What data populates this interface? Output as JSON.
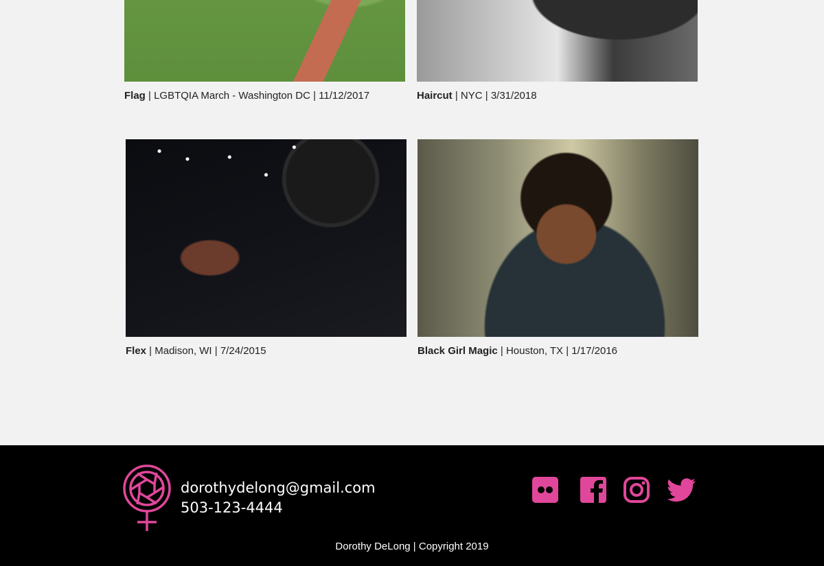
{
  "gallery": {
    "items": [
      {
        "title": "Flag",
        "details": " | LGBTQIA March - Washington DC | 11/12/2017"
      },
      {
        "title": "Haircut",
        "details": " | NYC | 3/31/2018"
      },
      {
        "title": "Flex",
        "details": " | Madison, WI | 7/24/2015"
      },
      {
        "title": "Black Girl Magic",
        "details": " | Houston, TX | 1/17/2016"
      }
    ]
  },
  "footer": {
    "email": "dorothydelong@gmail.com",
    "phone": "503-123-4444",
    "copyright": "Dorothy DeLong | Copyright 2019",
    "accent_color": "#e0479a",
    "social_icons": [
      "flickr-icon",
      "facebook-icon",
      "instagram-icon",
      "twitter-icon"
    ]
  }
}
